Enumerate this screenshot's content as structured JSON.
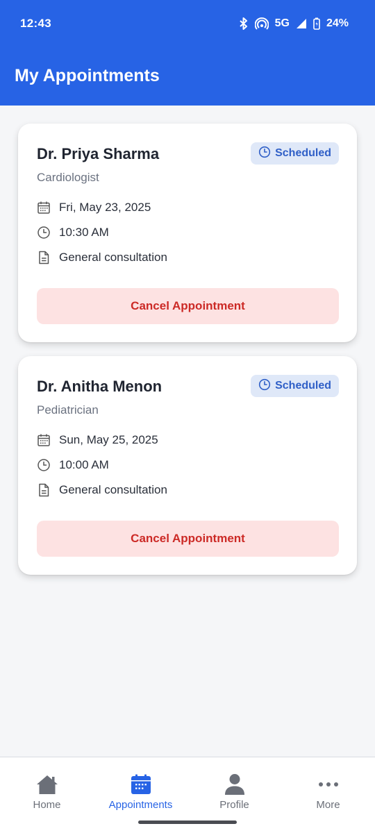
{
  "status_bar": {
    "time": "12:43",
    "network": "5G",
    "battery": "24%"
  },
  "header": {
    "title": "My Appointments"
  },
  "appointments": [
    {
      "doctor": "Dr. Priya Sharma",
      "specialty": "Cardiologist",
      "status": "Scheduled",
      "date": "Fri, May 23, 2025",
      "time": "10:30 AM",
      "type": "General consultation",
      "action_label": "Cancel Appointment"
    },
    {
      "doctor": "Dr. Anitha Menon",
      "specialty": "Pediatrician",
      "status": "Scheduled",
      "date": "Sun, May 25, 2025",
      "time": "10:00 AM",
      "type": "General consultation",
      "action_label": "Cancel Appointment"
    }
  ],
  "bottom_nav": {
    "items": [
      {
        "label": "Home",
        "icon": "home-icon",
        "active": false
      },
      {
        "label": "Appointments",
        "icon": "calendar-icon",
        "active": true
      },
      {
        "label": "Profile",
        "icon": "person-icon",
        "active": false
      },
      {
        "label": "More",
        "icon": "more-dots-icon",
        "active": false
      }
    ]
  },
  "colors": {
    "primary": "#2763e5",
    "badge_bg": "#dfe8f8",
    "badge_text": "#2f5fc7",
    "cancel_bg": "#fde2e2",
    "cancel_text": "#cc2a26"
  }
}
